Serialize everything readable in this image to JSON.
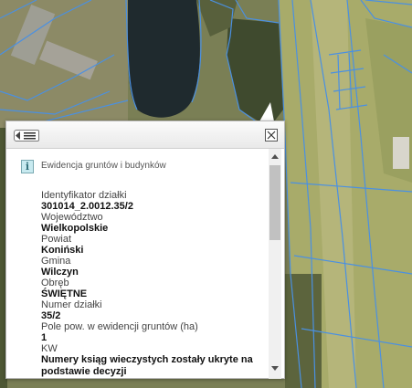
{
  "map": {
    "colors": {
      "water": "#1f2a2e",
      "field": "#a8ab6a",
      "forest": "#3f4a2e",
      "parcel_line": "#4a90e2"
    }
  },
  "popup": {
    "list_icon": "list-icon",
    "close_icon": "close-icon",
    "layer_icon": "info-icon",
    "layer_title": "Ewidencja gruntów i budynków",
    "fields": [
      {
        "label": "Identyfikator działki",
        "value": "301014_2.0012.35/2"
      },
      {
        "label": "Województwo",
        "value": "Wielkopolskie"
      },
      {
        "label": "Powiat",
        "value": "Koniński"
      },
      {
        "label": "Gmina",
        "value": "Wilczyn"
      },
      {
        "label": "Obręb",
        "value": "ŚWIĘTNE"
      },
      {
        "label": "Numer działki",
        "value": "35/2"
      },
      {
        "label": "Pole pow. w ewidencji gruntów (ha)",
        "value": "1"
      },
      {
        "label": "KW",
        "value": "Numery ksiąg wieczystych zostały ukryte na podstawie decyzji"
      }
    ]
  }
}
